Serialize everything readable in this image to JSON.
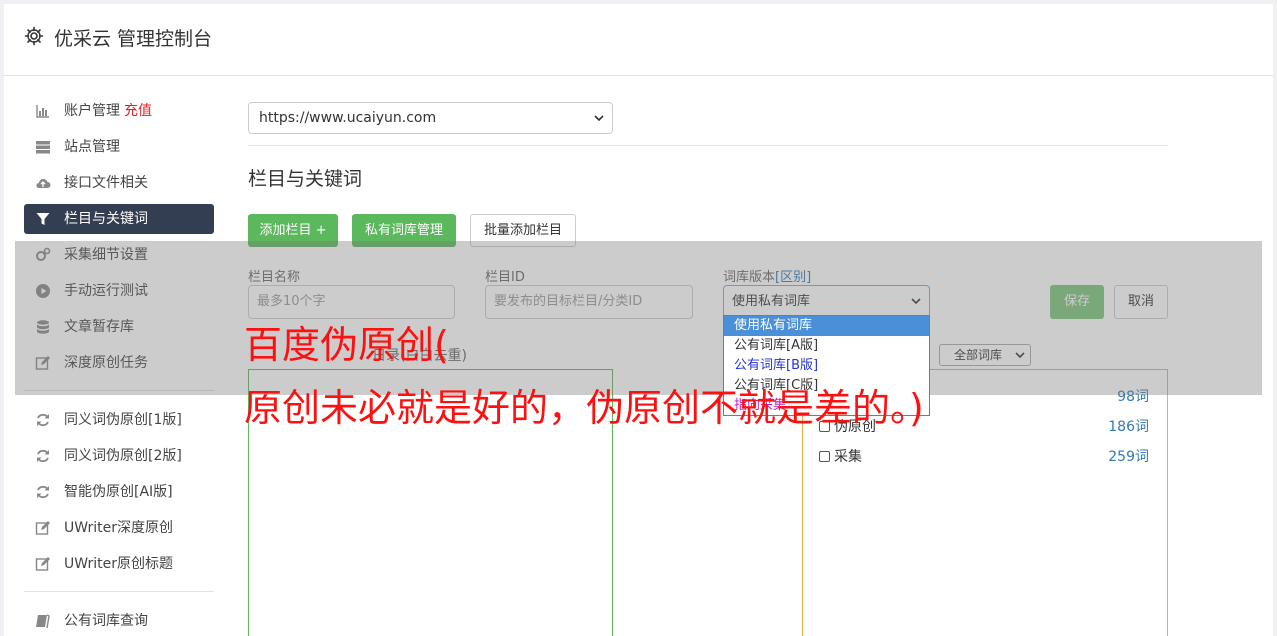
{
  "app": {
    "title": "优采云 管理控制台"
  },
  "sidebar": {
    "items": [
      {
        "label": "账户管理",
        "extra": "充值",
        "icon": "bar-chart-icon"
      },
      {
        "label": "站点管理",
        "icon": "server-icon"
      },
      {
        "label": "接口文件相关",
        "icon": "cloud-upload-icon"
      },
      {
        "label": "栏目与关键词",
        "icon": "filter-icon",
        "active": true
      },
      {
        "label": "采集细节设置",
        "icon": "cogs-icon"
      },
      {
        "label": "手动运行测试",
        "icon": "play-circle-icon"
      },
      {
        "label": "文章暂存库",
        "icon": "database-icon"
      },
      {
        "label": "深度原创任务",
        "icon": "edit-icon"
      },
      {
        "label": "同义词伪原创[1版]",
        "icon": "refresh-icon"
      },
      {
        "label": "同义词伪原创[2版]",
        "icon": "refresh-icon"
      },
      {
        "label": "智能伪原创[AI版]",
        "icon": "refresh-icon"
      },
      {
        "label": "UWriter深度原创",
        "icon": "edit-icon"
      },
      {
        "label": "UWriter原创标题",
        "icon": "edit-icon"
      },
      {
        "label": "公有词库查询",
        "icon": "book-icon"
      }
    ]
  },
  "main": {
    "site_select": {
      "value": "https://www.ucaiyun.com"
    },
    "section_title": "栏目与关键词",
    "buttons": {
      "add_column": "添加栏目 +",
      "private_lib": "私有词库管理",
      "batch_add": "批量添加栏目",
      "save": "保存",
      "cancel": "取消"
    },
    "form": {
      "name_label": "栏目名称",
      "name_placeholder": "最多10个字",
      "id_label": "栏目ID",
      "id_placeholder": "要发布的目标栏目/分类ID",
      "lib_label": "词库版本",
      "lib_label_link": "[区别]",
      "lib_value": "使用私有词库"
    },
    "dropdown_options": [
      "使用私有词库",
      "公有词库[A版]",
      "公有词库[B版]",
      "公有词库[C版]",
      "指向采集"
    ],
    "keywords_label_partial": "日录(白白去重)",
    "lib_filter_select": "全部词库",
    "lib_list": [
      {
        "label": "",
        "count": "98词"
      },
      {
        "label": "伪原创",
        "count": "186词"
      },
      {
        "label": "采集",
        "count": "259词"
      }
    ]
  },
  "watermark": {
    "line1": "百度伪原创(",
    "line2": "原创未必就是好的，伪原创不就是差的。)"
  }
}
